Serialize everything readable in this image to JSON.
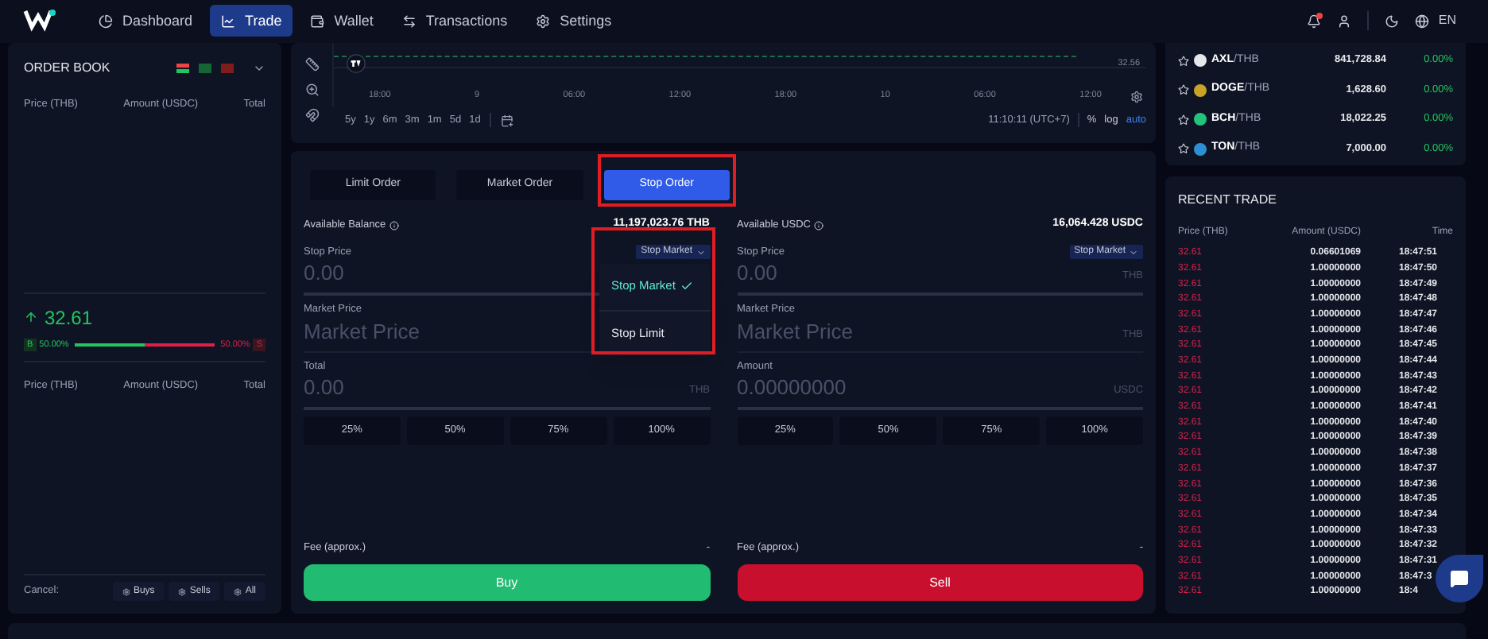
{
  "nav": [
    {
      "label": "Dashboard",
      "selected": false
    },
    {
      "label": "Trade",
      "selected": true
    },
    {
      "label": "Wallet",
      "selected": false
    },
    {
      "label": "Transactions",
      "selected": false
    },
    {
      "label": "Settings",
      "selected": false
    }
  ],
  "header": {
    "language": "EN",
    "notification_dot": true
  },
  "order_book": {
    "title": "ORDER BOOK",
    "columns": [
      "Price (THB)",
      "Amount (USDC)",
      "Total"
    ],
    "last_price": "32.61",
    "buy_label": "B",
    "buy_share": "50.00%",
    "level": 0.5,
    "sell_share": "50.00%",
    "sell_label": "S",
    "columns_2": [
      "Price (THB)",
      "Amount (USDC)",
      "Total"
    ],
    "cancel_label": "Cancel:",
    "cancel_buttons": [
      "Buys",
      "Sells",
      "All"
    ]
  },
  "chart": {
    "price_label": "32.56",
    "x_labels": [
      "18:00",
      "9",
      "06:00",
      "12:00",
      "18:00",
      "10",
      "06:00",
      "12:00"
    ],
    "ranges": [
      "5y",
      "1y",
      "6m",
      "3m",
      "1m",
      "5d",
      "1d"
    ],
    "clock": "11:10:11 (UTC+7)",
    "options": [
      {
        "label": "%",
        "selected": false
      },
      {
        "label": "log",
        "selected": false
      },
      {
        "label": "auto",
        "selected": true
      }
    ]
  },
  "order_tabs": [
    {
      "label": "Limit Order",
      "selected": false,
      "highlighted": false
    },
    {
      "label": "Market Order",
      "selected": false,
      "highlighted": false
    },
    {
      "label": "Stop Order",
      "selected": true,
      "highlighted": true
    }
  ],
  "sides": [
    {
      "kind": "buy",
      "balance_label": "Available Balance",
      "balance": "11,197,023.76 THB",
      "stop_label": "Stop Price",
      "dropdown": "Stop Market",
      "dropdown_open": true,
      "dropdown_highlighted": true,
      "menu": [
        {
          "label": "Stop Market",
          "selected": true
        },
        {
          "label": "Stop Limit",
          "selected": false
        }
      ],
      "fields": [
        {
          "label": "Market Price",
          "placeholder": "Market Price"
        },
        {
          "label": "Total",
          "placeholder": "0.00",
          "unit": "THB"
        }
      ],
      "stop_placeholder": "0.00",
      "percents": [
        "25%",
        "50%",
        "75%",
        "100%"
      ],
      "fee_label": "Fee (approx.)",
      "fee": "-",
      "action": "Buy"
    },
    {
      "kind": "sell",
      "balance_label": "Available USDC",
      "balance": "16,064.428 USDC",
      "stop_label": "Stop Price",
      "dropdown": "Stop Market",
      "dropdown_open": false,
      "dropdown_highlighted": false,
      "stop_unit": "THB",
      "fields": [
        {
          "label": "Market Price",
          "placeholder": "Market Price",
          "unit": "THB"
        },
        {
          "label": "Amount",
          "placeholder": "0.00000000",
          "unit": "USDC"
        }
      ],
      "stop_placeholder": "0.00",
      "percents": [
        "25%",
        "50%",
        "75%",
        "100%"
      ],
      "fee_label": "Fee (approx.)",
      "fee": "-",
      "action": "Sell"
    }
  ],
  "markets": [
    {
      "base": "AXL",
      "quote": "/THB",
      "price": "841,728.84",
      "change": "0.00%",
      "color": "#e5e7eb"
    },
    {
      "base": "DOGE",
      "quote": "/THB",
      "price": "1,628.60",
      "change": "0.00%",
      "color": "#c9a227"
    },
    {
      "base": "BCH",
      "quote": "/THB",
      "price": "18,022.25",
      "change": "0.00%",
      "color": "#22c37a"
    },
    {
      "base": "TON",
      "quote": "/THB",
      "price": "7,000.00",
      "change": "0.00%",
      "color": "#2d8fd6"
    }
  ],
  "recent_trade": {
    "title": "RECENT TRADE",
    "columns": [
      "Price (THB)",
      "Amount (USDC)",
      "Time"
    ],
    "rows": [
      [
        "32.61",
        "0.06601069",
        "18:47:51"
      ],
      [
        "32.61",
        "1.00000000",
        "18:47:50"
      ],
      [
        "32.61",
        "1.00000000",
        "18:47:49"
      ],
      [
        "32.61",
        "1.00000000",
        "18:47:48"
      ],
      [
        "32.61",
        "1.00000000",
        "18:47:47"
      ],
      [
        "32.61",
        "1.00000000",
        "18:47:46"
      ],
      [
        "32.61",
        "1.00000000",
        "18:47:45"
      ],
      [
        "32.61",
        "1.00000000",
        "18:47:44"
      ],
      [
        "32.61",
        "1.00000000",
        "18:47:43"
      ],
      [
        "32.61",
        "1.00000000",
        "18:47:42"
      ],
      [
        "32.61",
        "1.00000000",
        "18:47:41"
      ],
      [
        "32.61",
        "1.00000000",
        "18:47:40"
      ],
      [
        "32.61",
        "1.00000000",
        "18:47:39"
      ],
      [
        "32.61",
        "1.00000000",
        "18:47:38"
      ],
      [
        "32.61",
        "1.00000000",
        "18:47:37"
      ],
      [
        "32.61",
        "1.00000000",
        "18:47:36"
      ],
      [
        "32.61",
        "1.00000000",
        "18:47:35"
      ],
      [
        "32.61",
        "1.00000000",
        "18:47:34"
      ],
      [
        "32.61",
        "1.00000000",
        "18:47:33"
      ],
      [
        "32.61",
        "1.00000000",
        "18:47:32"
      ],
      [
        "32.61",
        "1.00000000",
        "18:47:31"
      ],
      [
        "32.61",
        "1.00000000",
        "18:47:3"
      ],
      [
        "32.61",
        "1.00000000",
        "18:4"
      ]
    ]
  }
}
